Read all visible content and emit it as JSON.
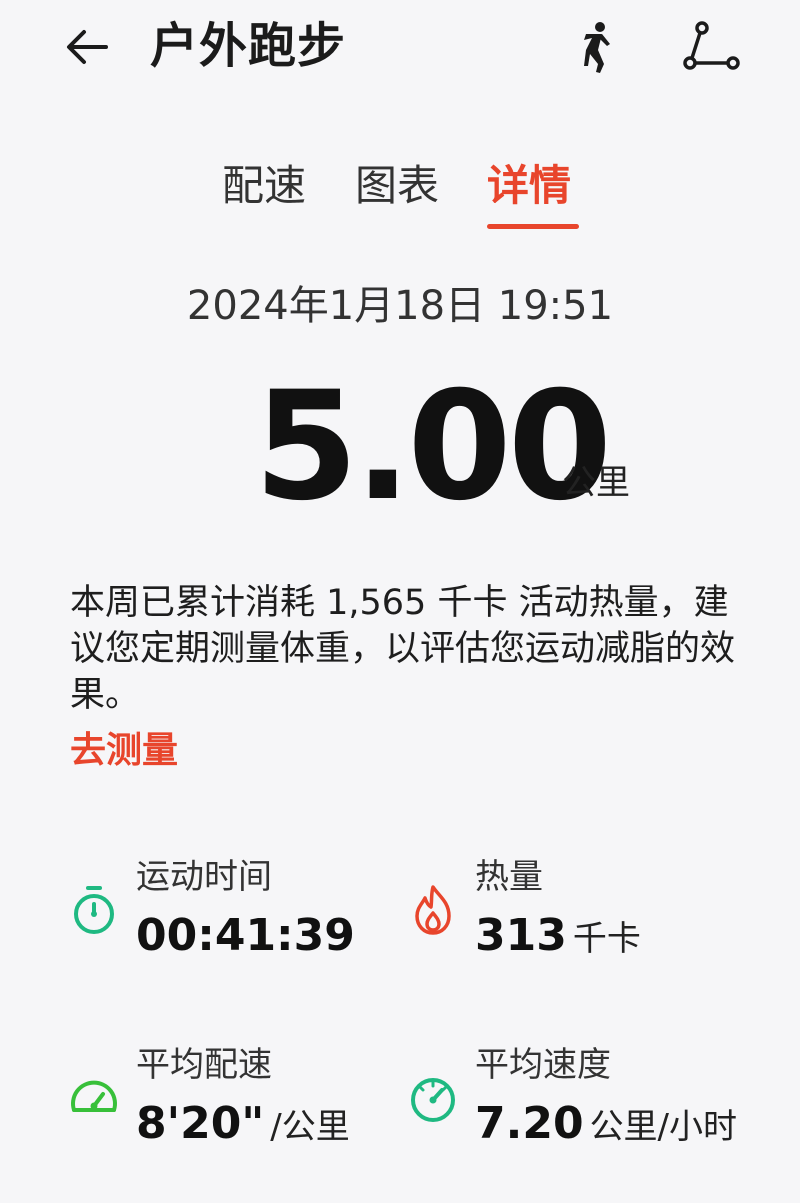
{
  "header": {
    "title": "户外跑步",
    "back_icon": "arrow-left-icon",
    "runner_icon": "runner-icon",
    "share_icon": "route-share-icon"
  },
  "tabs": [
    {
      "label": "配速",
      "active": false
    },
    {
      "label": "图表",
      "active": false
    },
    {
      "label": "详情",
      "active": true
    }
  ],
  "accent_color": "#e8452c",
  "summary": {
    "datetime": "2024年1月18日 19:51",
    "distance": "5.00",
    "distance_unit": "公里"
  },
  "tip": {
    "text": "本周已累计消耗 1,565 千卡 活动热量，建议您定期测量体重，以评估您运动减脂的效果。",
    "link": "去测量"
  },
  "stats": {
    "time": {
      "label": "运动时间",
      "value": "00:41:39",
      "unit": "",
      "icon": "stopwatch-icon",
      "color": "#1fb982"
    },
    "calories": {
      "label": "热量",
      "value": "313",
      "unit": "千卡",
      "icon": "flame-icon",
      "color": "#e8452c"
    },
    "pace": {
      "label": "平均配速",
      "value": "8'20\"",
      "unit": "/公里",
      "icon": "speedometer-icon",
      "color": "#38c03a"
    },
    "speed": {
      "label": "平均速度",
      "value": "7.20",
      "unit": "公里/小时",
      "icon": "gauge-icon",
      "color": "#1fb982"
    }
  }
}
